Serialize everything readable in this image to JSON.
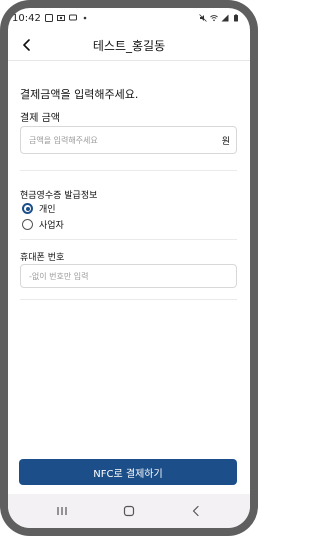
{
  "statusbar": {
    "time": "10:42"
  },
  "header": {
    "title": "테스트_홍길동"
  },
  "form": {
    "instruction": "결제금액을 입력해주세요.",
    "amount_label": "결제 금액",
    "amount_placeholder": "금액을 입력해주세요",
    "amount_unit": "원",
    "receipt_label": "현금영수증 발급정보",
    "receipt_options": [
      "개인",
      "사업자"
    ],
    "selected_option": "개인",
    "phone_label": "휴대폰 번호",
    "phone_placeholder": "-없이 번호만 입력"
  },
  "cta": {
    "label": "NFC로 결제하기"
  },
  "colors": {
    "primary": "#1c4f8a",
    "frame": "#5f5f5f"
  }
}
